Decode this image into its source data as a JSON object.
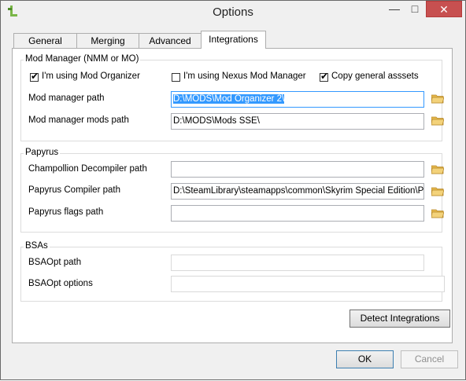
{
  "window": {
    "title": "Options",
    "minimize": "—",
    "maximize": "□",
    "close": "✕"
  },
  "tabs": [
    "General",
    "Merging",
    "Advanced",
    "Integrations"
  ],
  "mod_manager": {
    "group_label": "Mod Manager (NMM or MO)",
    "checkbox_mo": {
      "label": "I'm using Mod Organizer",
      "checked": true
    },
    "checkbox_nmm": {
      "label": "I'm using Nexus Mod Manager",
      "checked": false
    },
    "checkbox_copy": {
      "label": "Copy general asssets",
      "checked": true
    },
    "path_label": "Mod manager path",
    "path_value": "D:\\MODS\\Mod Organizer 2\\",
    "mods_path_label": "Mod manager mods path",
    "mods_path_value": "D:\\MODS\\Mods SSE\\"
  },
  "papyrus": {
    "group_label": "Papyrus",
    "decompiler_label": "Champollion Decompiler path",
    "decompiler_value": "",
    "compiler_label": "Papyrus Compiler path",
    "compiler_value": "D:\\SteamLibrary\\steamapps\\common\\Skyrim Special Edition\\Papyr",
    "flags_label": "Papyrus flags path",
    "flags_value": ""
  },
  "bsas": {
    "group_label": "BSAs",
    "path_label": "BSAOpt path",
    "path_value": "",
    "options_label": "BSAOpt options",
    "options_value": ""
  },
  "buttons": {
    "detect": "Detect Integrations",
    "ok": "OK",
    "cancel": "Cancel"
  },
  "icons": {
    "app": "tes5edit-icon",
    "browse": "folder-icon",
    "check": "✔"
  },
  "colors": {
    "close_button": "#c75050",
    "focus_border": "#3399ff",
    "selection": "#3399ff"
  }
}
